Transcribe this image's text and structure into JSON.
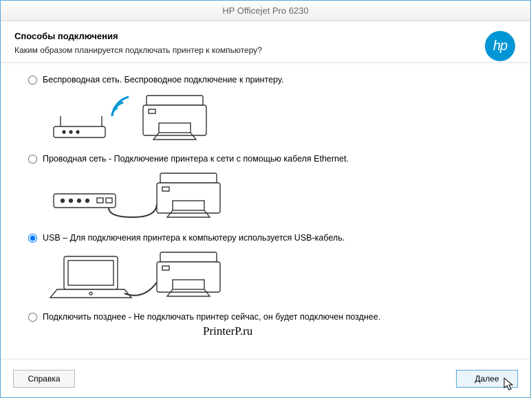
{
  "window": {
    "title": "HP Officejet Pro 6230"
  },
  "header": {
    "title": "Способы подключения",
    "subtitle": "Каким образом планируется подключать принтер к компьютеру?"
  },
  "logo": {
    "text": "hp"
  },
  "options": {
    "wireless": {
      "label": "Беспроводная сеть. Беспроводное подключение к принтеру.",
      "selected": false
    },
    "wired": {
      "label": "Проводная сеть - Подключение принтера к сети с помощью кабеля Ethernet.",
      "selected": false
    },
    "usb": {
      "label": "USB – Для подключения принтера к компьютеру используется USB-кабель.",
      "selected": true
    },
    "later": {
      "label": "Подключить позднее - Не подключать принтер сейчас, он будет подключен  позднее.",
      "selected": false
    }
  },
  "watermark": "PrinterP.ru",
  "footer": {
    "help": "Справка",
    "next": "Далее"
  }
}
